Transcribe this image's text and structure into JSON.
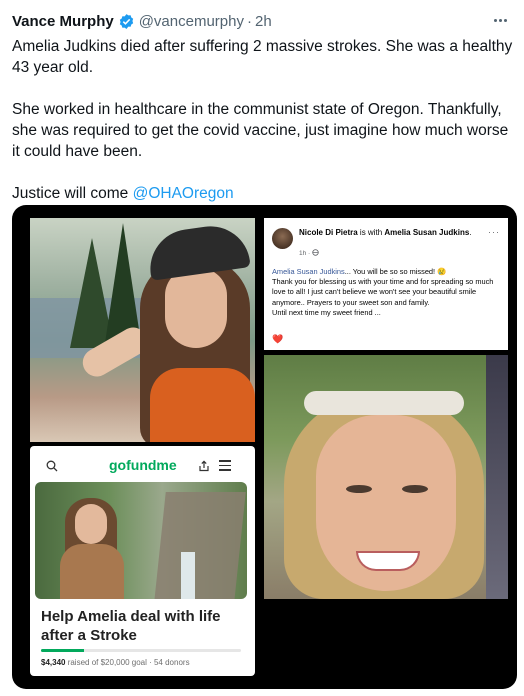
{
  "tweet": {
    "author_name": "Vance Murphy",
    "handle": "@vancemurphy",
    "separator": "·",
    "time": "2h",
    "line1": "Amelia Judkins died after suffering 2 massive strokes. She was a healthy 43 year old.",
    "line2": "She worked in healthcare in the communist state of Oregon. Thankfully, she was required to get the covid vaccine, just imagine how much worse it could have been.",
    "line3_prefix": "Justice will come ",
    "mention": "@OHAOregon",
    "icons": {
      "verified": "verified-badge-icon",
      "more": "more-options-icon"
    },
    "colors": {
      "link": "#1d9bf0",
      "verified": "#1d9bf0",
      "muted": "#536471"
    }
  },
  "facebook_post": {
    "author": "Nicole Di Pietra",
    "with_text": " is with ",
    "tagged": "Amelia Susan Judkins",
    "period": ".",
    "time": "1h · ",
    "more": "···",
    "tag_inline": "Amelia Susan Judkins",
    "line1": "... You will be so so missed! 😢",
    "line2": "Thank you for blessing us with your time and for spreading so much love to all! I just can't believe we won't see your beautiful smile anymore.. Prayers to your sweet son and family.",
    "line3": "Until next time my sweet friend ...",
    "heart": "❤️"
  },
  "gofundme": {
    "logo": "gofundme",
    "title": "Help Amelia deal with life after a Stroke",
    "raised": "$4,340",
    "raised_of": " raised of $20,000 goal · ",
    "donors": "54 donors",
    "progress": 0.217,
    "icons": {
      "search": "search-icon",
      "share": "share-icon",
      "menu": "menu-icon"
    },
    "colors": {
      "brand": "#02a95c"
    }
  }
}
